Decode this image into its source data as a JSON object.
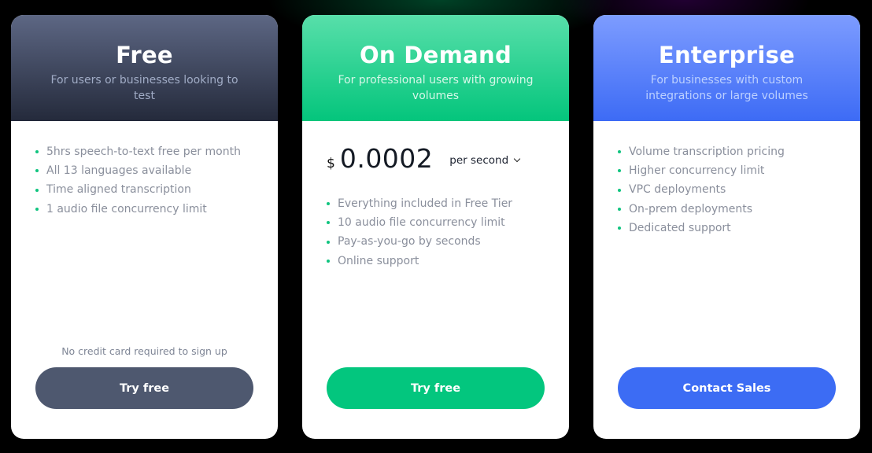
{
  "plans": [
    {
      "title": "Free",
      "subtitle": "For users or businesses looking to test",
      "features": [
        "5hrs speech-to-text free per month",
        "All 13 languages available",
        "Time aligned transcription",
        "1 audio file concurrency limit"
      ],
      "note": "No credit card required to sign up",
      "cta": "Try free",
      "accent": "#4e586f"
    },
    {
      "title": "On Demand",
      "subtitle": "For professional users with growing volumes",
      "price": {
        "currency": "$",
        "amount": "0.0002",
        "unit": "per second"
      },
      "features": [
        "Everything included in Free Tier",
        "10 audio file concurrency limit",
        "Pay-as-you-go by seconds",
        "Online support"
      ],
      "cta": "Try free",
      "accent": "#03c67e"
    },
    {
      "title": "Enterprise",
      "subtitle": "For businesses with custom integrations or large volumes",
      "features": [
        "Volume transcription pricing",
        "Higher concurrency limit",
        "VPC deployments",
        "On-prem deployments",
        "Dedicated support"
      ],
      "cta": "Contact Sales",
      "accent": "#3c6cf4"
    }
  ],
  "icons": {
    "bullet": "green-dot-icon",
    "price_unit_dropdown": "chevron-down-icon"
  }
}
